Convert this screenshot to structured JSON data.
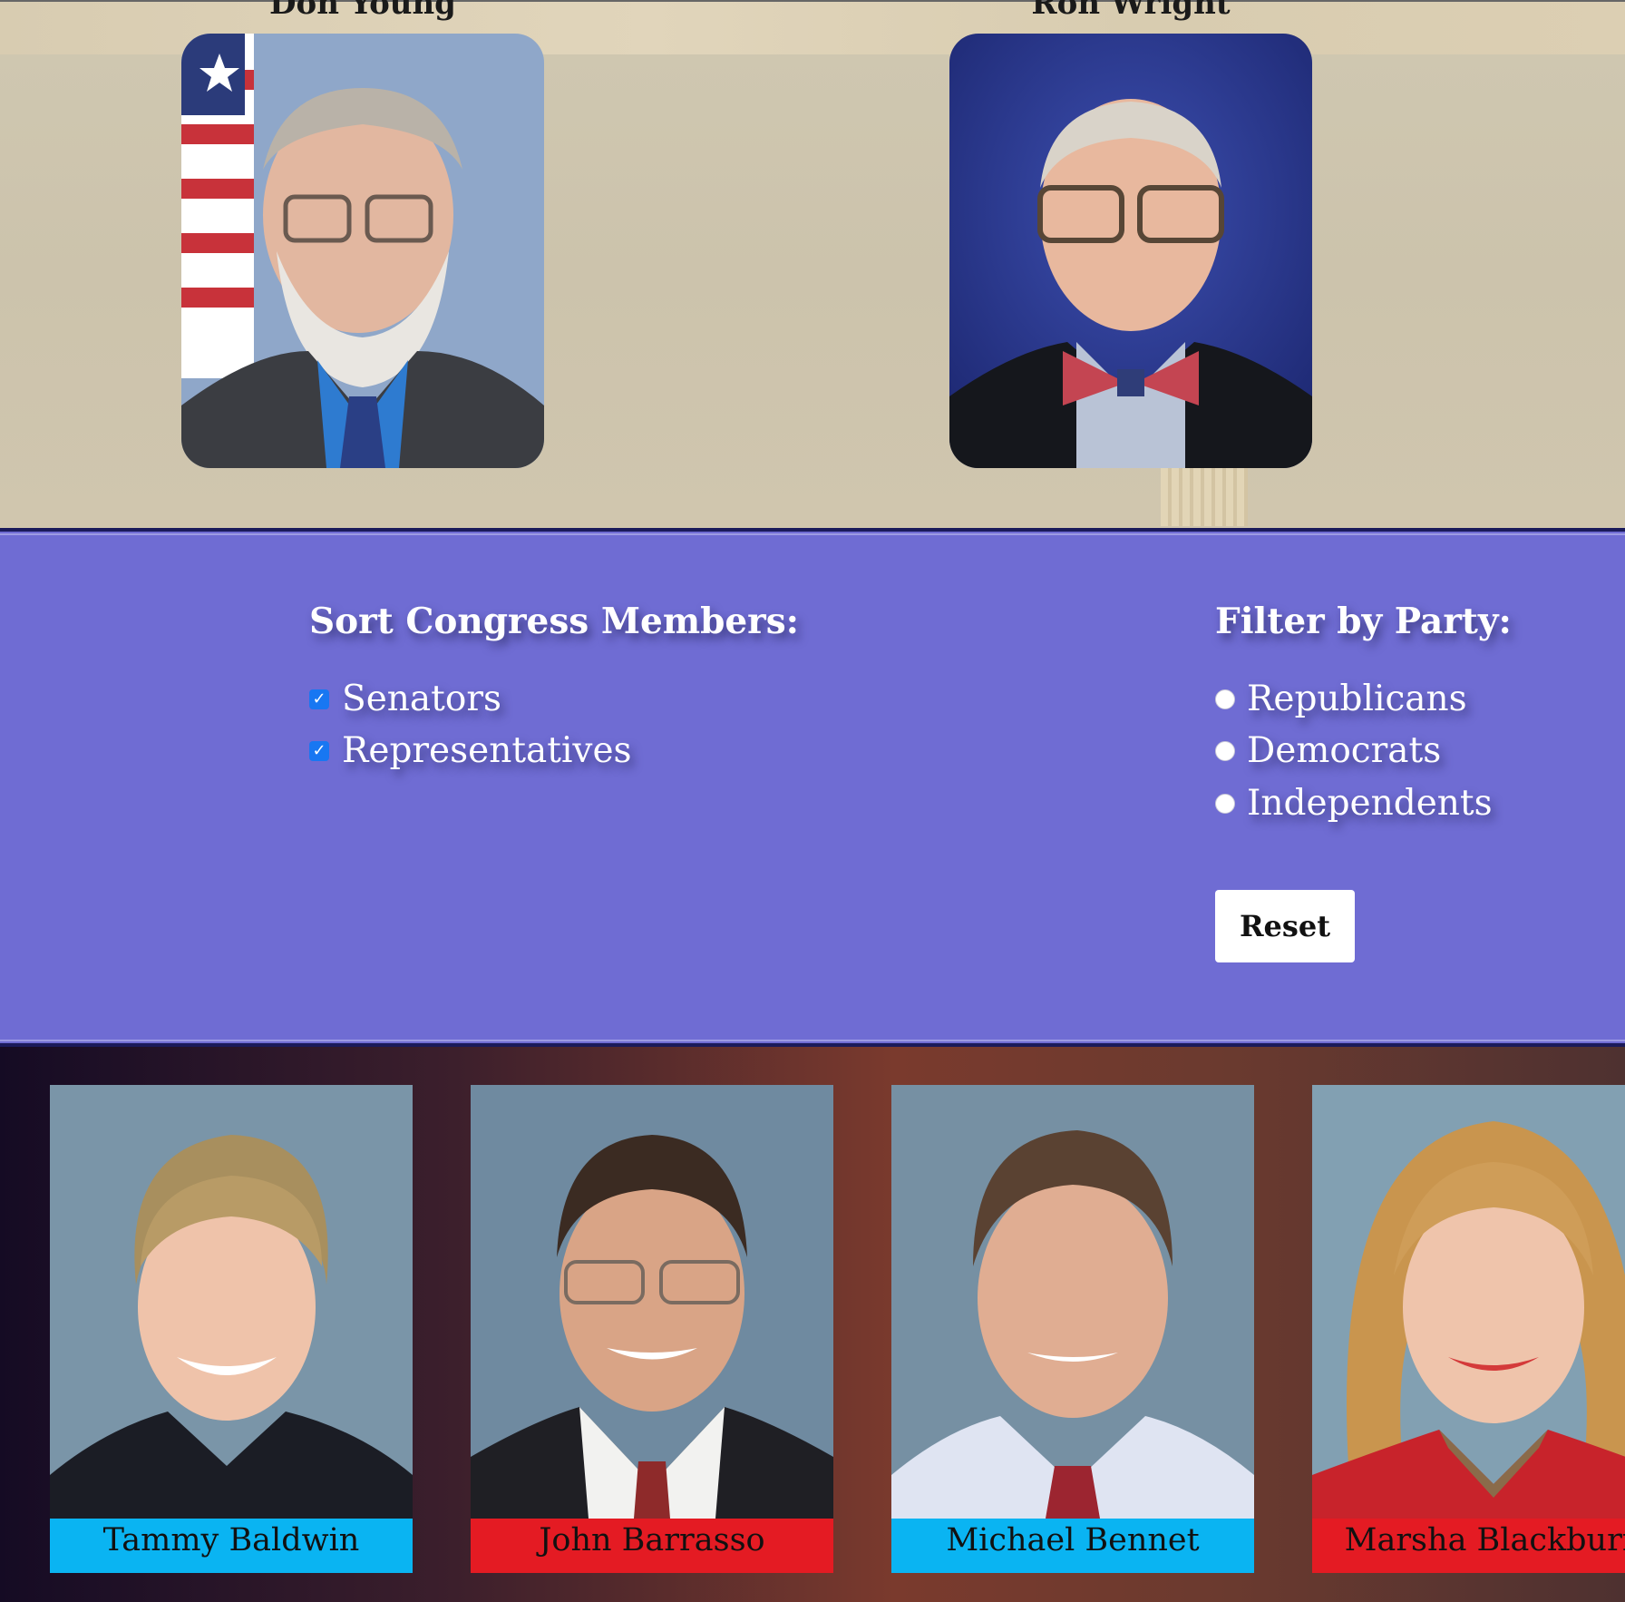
{
  "representatives": [
    {
      "name": "Don Young"
    },
    {
      "name": "Ron Wright"
    }
  ],
  "sort": {
    "heading": "Sort Congress Members:",
    "options": [
      {
        "label": "Senators",
        "checked": true
      },
      {
        "label": "Representatives",
        "checked": true
      }
    ]
  },
  "filter": {
    "heading": "Filter by Party:",
    "options": [
      {
        "label": "Republicans"
      },
      {
        "label": "Democrats"
      },
      {
        "label": "Independents"
      }
    ],
    "reset_label": "Reset"
  },
  "senators": [
    {
      "name": "Tammy Baldwin",
      "party_color": "#0ab4f2"
    },
    {
      "name": "John Barrasso",
      "party_color": "#e41b23"
    },
    {
      "name": "Michael Bennet",
      "party_color": "#0ab4f2"
    },
    {
      "name": "Marsha Blackburn",
      "party_color": "#e41b23"
    }
  ],
  "colors": {
    "controls_bg": "#6f6cd3",
    "democrat": "#0ab4f2",
    "republican": "#e41b23"
  }
}
